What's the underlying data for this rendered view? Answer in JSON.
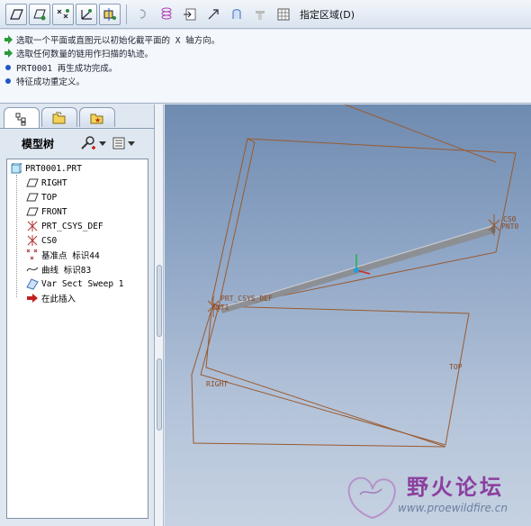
{
  "toolbar": {
    "buttons": [
      "sketch-plane-icon",
      "show-datum-plane-icon",
      "show-datum-point-icon",
      "show-csys-icon",
      "show-axis-icon",
      "undo-icon",
      "spring-icon",
      "import-icon",
      "select-arrow-icon",
      "layer-icon",
      "repaint-icon",
      "grid-icon"
    ],
    "region_label": "指定区域(D)"
  },
  "messages": [
    {
      "icon": "arrow-icon",
      "text": "选取一个平面或直图元以初始化截平面的 X 轴方向。"
    },
    {
      "icon": "arrow-icon",
      "text": "选取任何数量的链用作扫描的轨迹。"
    },
    {
      "icon": "info-dot-icon",
      "text": "PRT0001 再生成功完成。"
    },
    {
      "icon": "info-dot-icon",
      "text": "特征成功重定义。"
    }
  ],
  "panel": {
    "tabs": [
      "model-tree-tab",
      "folder-tab",
      "favorites-tab"
    ],
    "title": "模型树"
  },
  "tree": [
    {
      "label": "PRT0001.PRT",
      "icon": "part-icon",
      "indent": 0
    },
    {
      "label": "RIGHT",
      "icon": "datum-plane-icon",
      "indent": 1
    },
    {
      "label": "TOP",
      "icon": "datum-plane-icon",
      "indent": 1
    },
    {
      "label": "FRONT",
      "icon": "datum-plane-icon",
      "indent": 1
    },
    {
      "label": "PRT_CSYS_DEF",
      "icon": "csys-icon",
      "indent": 1
    },
    {
      "label": "CS0",
      "icon": "csys-icon",
      "indent": 1
    },
    {
      "label": "基准点 标识44",
      "icon": "datum-point-icon",
      "indent": 1
    },
    {
      "label": "曲线 标识83",
      "icon": "curve-icon",
      "indent": 1
    },
    {
      "label": "Var Sect Sweep 1",
      "icon": "sweep-icon",
      "indent": 1
    },
    {
      "label": "在此插入",
      "icon": "insert-arrow-icon",
      "indent": 1
    }
  ],
  "viewport": {
    "labels": {
      "csys_def": "PRT_CSYS_DEF",
      "pnt1": "PNT1",
      "cs0": "CS0",
      "pnt0": "PNT0",
      "top": "TOP",
      "right": "RIGHT"
    },
    "colors": {
      "datum": "#9a5a2e",
      "sweep": "#8c8f94",
      "bg_top": "#6f8bb0",
      "bg_bottom": "#c6d2e2"
    }
  },
  "watermark": {
    "title": "野火论坛",
    "url": "www.proewildfire.cn"
  }
}
